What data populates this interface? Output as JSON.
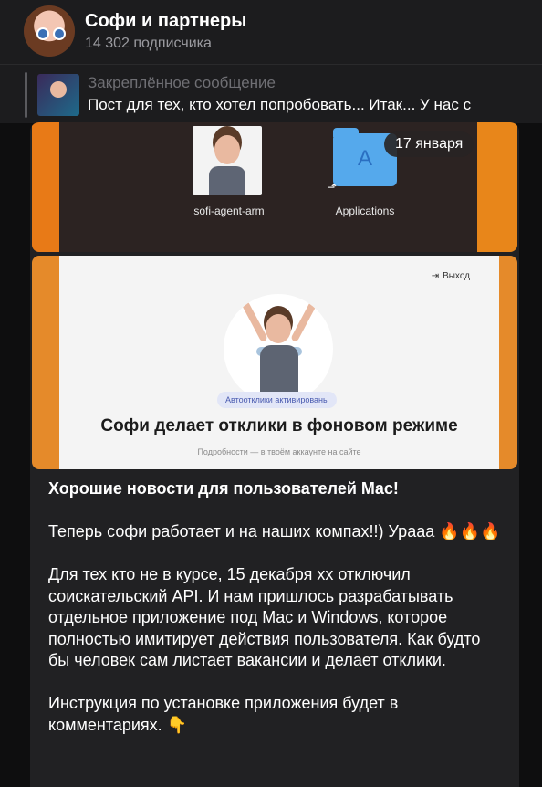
{
  "header": {
    "channel_title": "Софи и партнеры",
    "subscribers": "14 302 подписчика"
  },
  "pinned": {
    "label": "Закреплённое сообщение",
    "text": "Пост для тех, кто хотел попробовать... Итак... У нас с"
  },
  "post": {
    "date_badge": "17 января",
    "image1": {
      "app_label": "sofi-agent-arm",
      "folder_label": "Applications",
      "alias_arrow": "⬏"
    },
    "image2": {
      "exit_label": "Выход",
      "badge": "Автоотклики активированы",
      "heading": "Софи делает отклики в фоновом режиме",
      "subtext": "Подробности — в твоём аккаунте на сайте"
    },
    "paragraphs": {
      "p1": "Хорошие новости для пользователей Mac!",
      "p2": "Теперь софи работает и на наших компах!!) Урааа 🔥🔥🔥",
      "p3": "Для тех кто не в курсе, 15 декабря хх отключил соискательский API. И нам пришлось разрабатывать отдельное приложение под Mac и Windows, которое полностью имитирует действия пользователя. Как будто бы человек сам листает вакансии и делает отклики.",
      "p4": "Инструкция по установке приложения будет в комментариях. 👇"
    }
  },
  "colors": {
    "background": "#0e0e0f",
    "panel": "#1c1c1e",
    "bubble": "#212123",
    "accent_orange": "#e8861a",
    "folder_blue": "#55a9ec"
  }
}
